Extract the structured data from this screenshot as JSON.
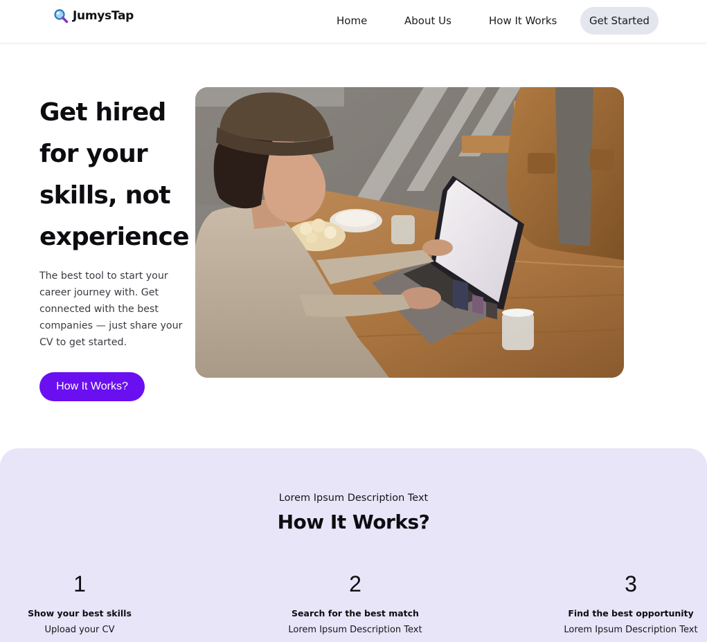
{
  "brand": {
    "name": "JumysTap",
    "icon": "magnifier-icon"
  },
  "nav": {
    "home": "Home",
    "about": "About Us",
    "how": "How It Works",
    "cta": "Get Started"
  },
  "hero": {
    "title": "Get hired for your skills, not experience",
    "description": "The best tool to start your career journey with. Get connected with the best companies — just share your CV to get started.",
    "button": "How It Works?",
    "image": "photo-woman-using-laptop"
  },
  "how_it_works": {
    "eyebrow": "Lorem Ipsum Description Text",
    "title": "How It Works?",
    "steps": [
      {
        "number": "1",
        "title": "Show your best skills",
        "description": "Upload your CV"
      },
      {
        "number": "2",
        "title": "Search for the best match",
        "description": "Lorem Ipsum Description Text"
      },
      {
        "number": "3",
        "title": "Find the best opportunity",
        "description": "Lorem Ipsum Description Text"
      }
    ]
  },
  "colors": {
    "accent": "#6a0ff0",
    "section_bg": "#e8e5f8",
    "cta_bg": "#e3e6ee"
  }
}
